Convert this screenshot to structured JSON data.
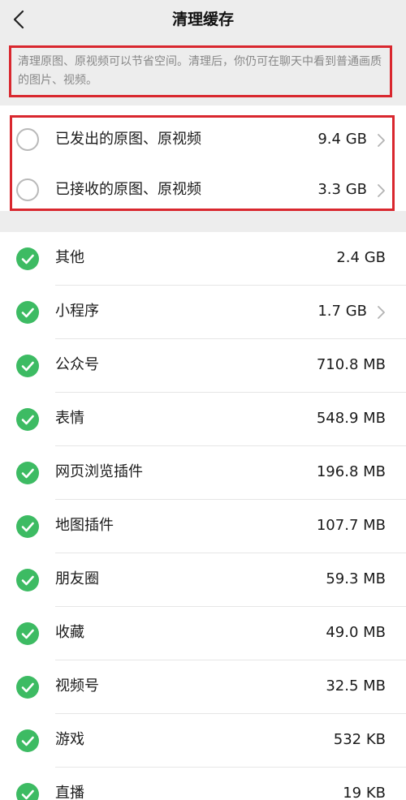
{
  "nav": {
    "title": "清理缓存"
  },
  "tip": {
    "text": "清理原图、原视频可以节省空间。清理后，你仍可在聊天中看到普通画质的图片、视频。"
  },
  "originals": [
    {
      "label": "已发出的原图、原视频",
      "size": "9.4 GB"
    },
    {
      "label": "已接收的原图、原视频",
      "size": "3.3 GB"
    }
  ],
  "items": [
    {
      "label": "其他",
      "size": "2.4 GB"
    },
    {
      "label": "小程序",
      "size": "1.7 GB"
    },
    {
      "label": "公众号",
      "size": "710.8 MB"
    },
    {
      "label": "表情",
      "size": "548.9 MB"
    },
    {
      "label": "网页浏览插件",
      "size": "196.8 MB"
    },
    {
      "label": "地图插件",
      "size": "107.7 MB"
    },
    {
      "label": "朋友圈",
      "size": "59.3 MB"
    },
    {
      "label": "收藏",
      "size": "49.0 MB"
    },
    {
      "label": "视频号",
      "size": "32.5 MB"
    },
    {
      "label": "游戏",
      "size": "532 KB"
    },
    {
      "label": "直播",
      "size": "19 KB"
    }
  ],
  "colors": {
    "checked": "#3dbb63",
    "highlight_border": "#d9272e",
    "section_background": "#ededed"
  },
  "icons": {
    "back": "chevron-left-icon",
    "unchecked": "radio-unchecked-icon",
    "checked": "checkmark-circle-icon",
    "disclosure": "chevron-right-icon"
  }
}
